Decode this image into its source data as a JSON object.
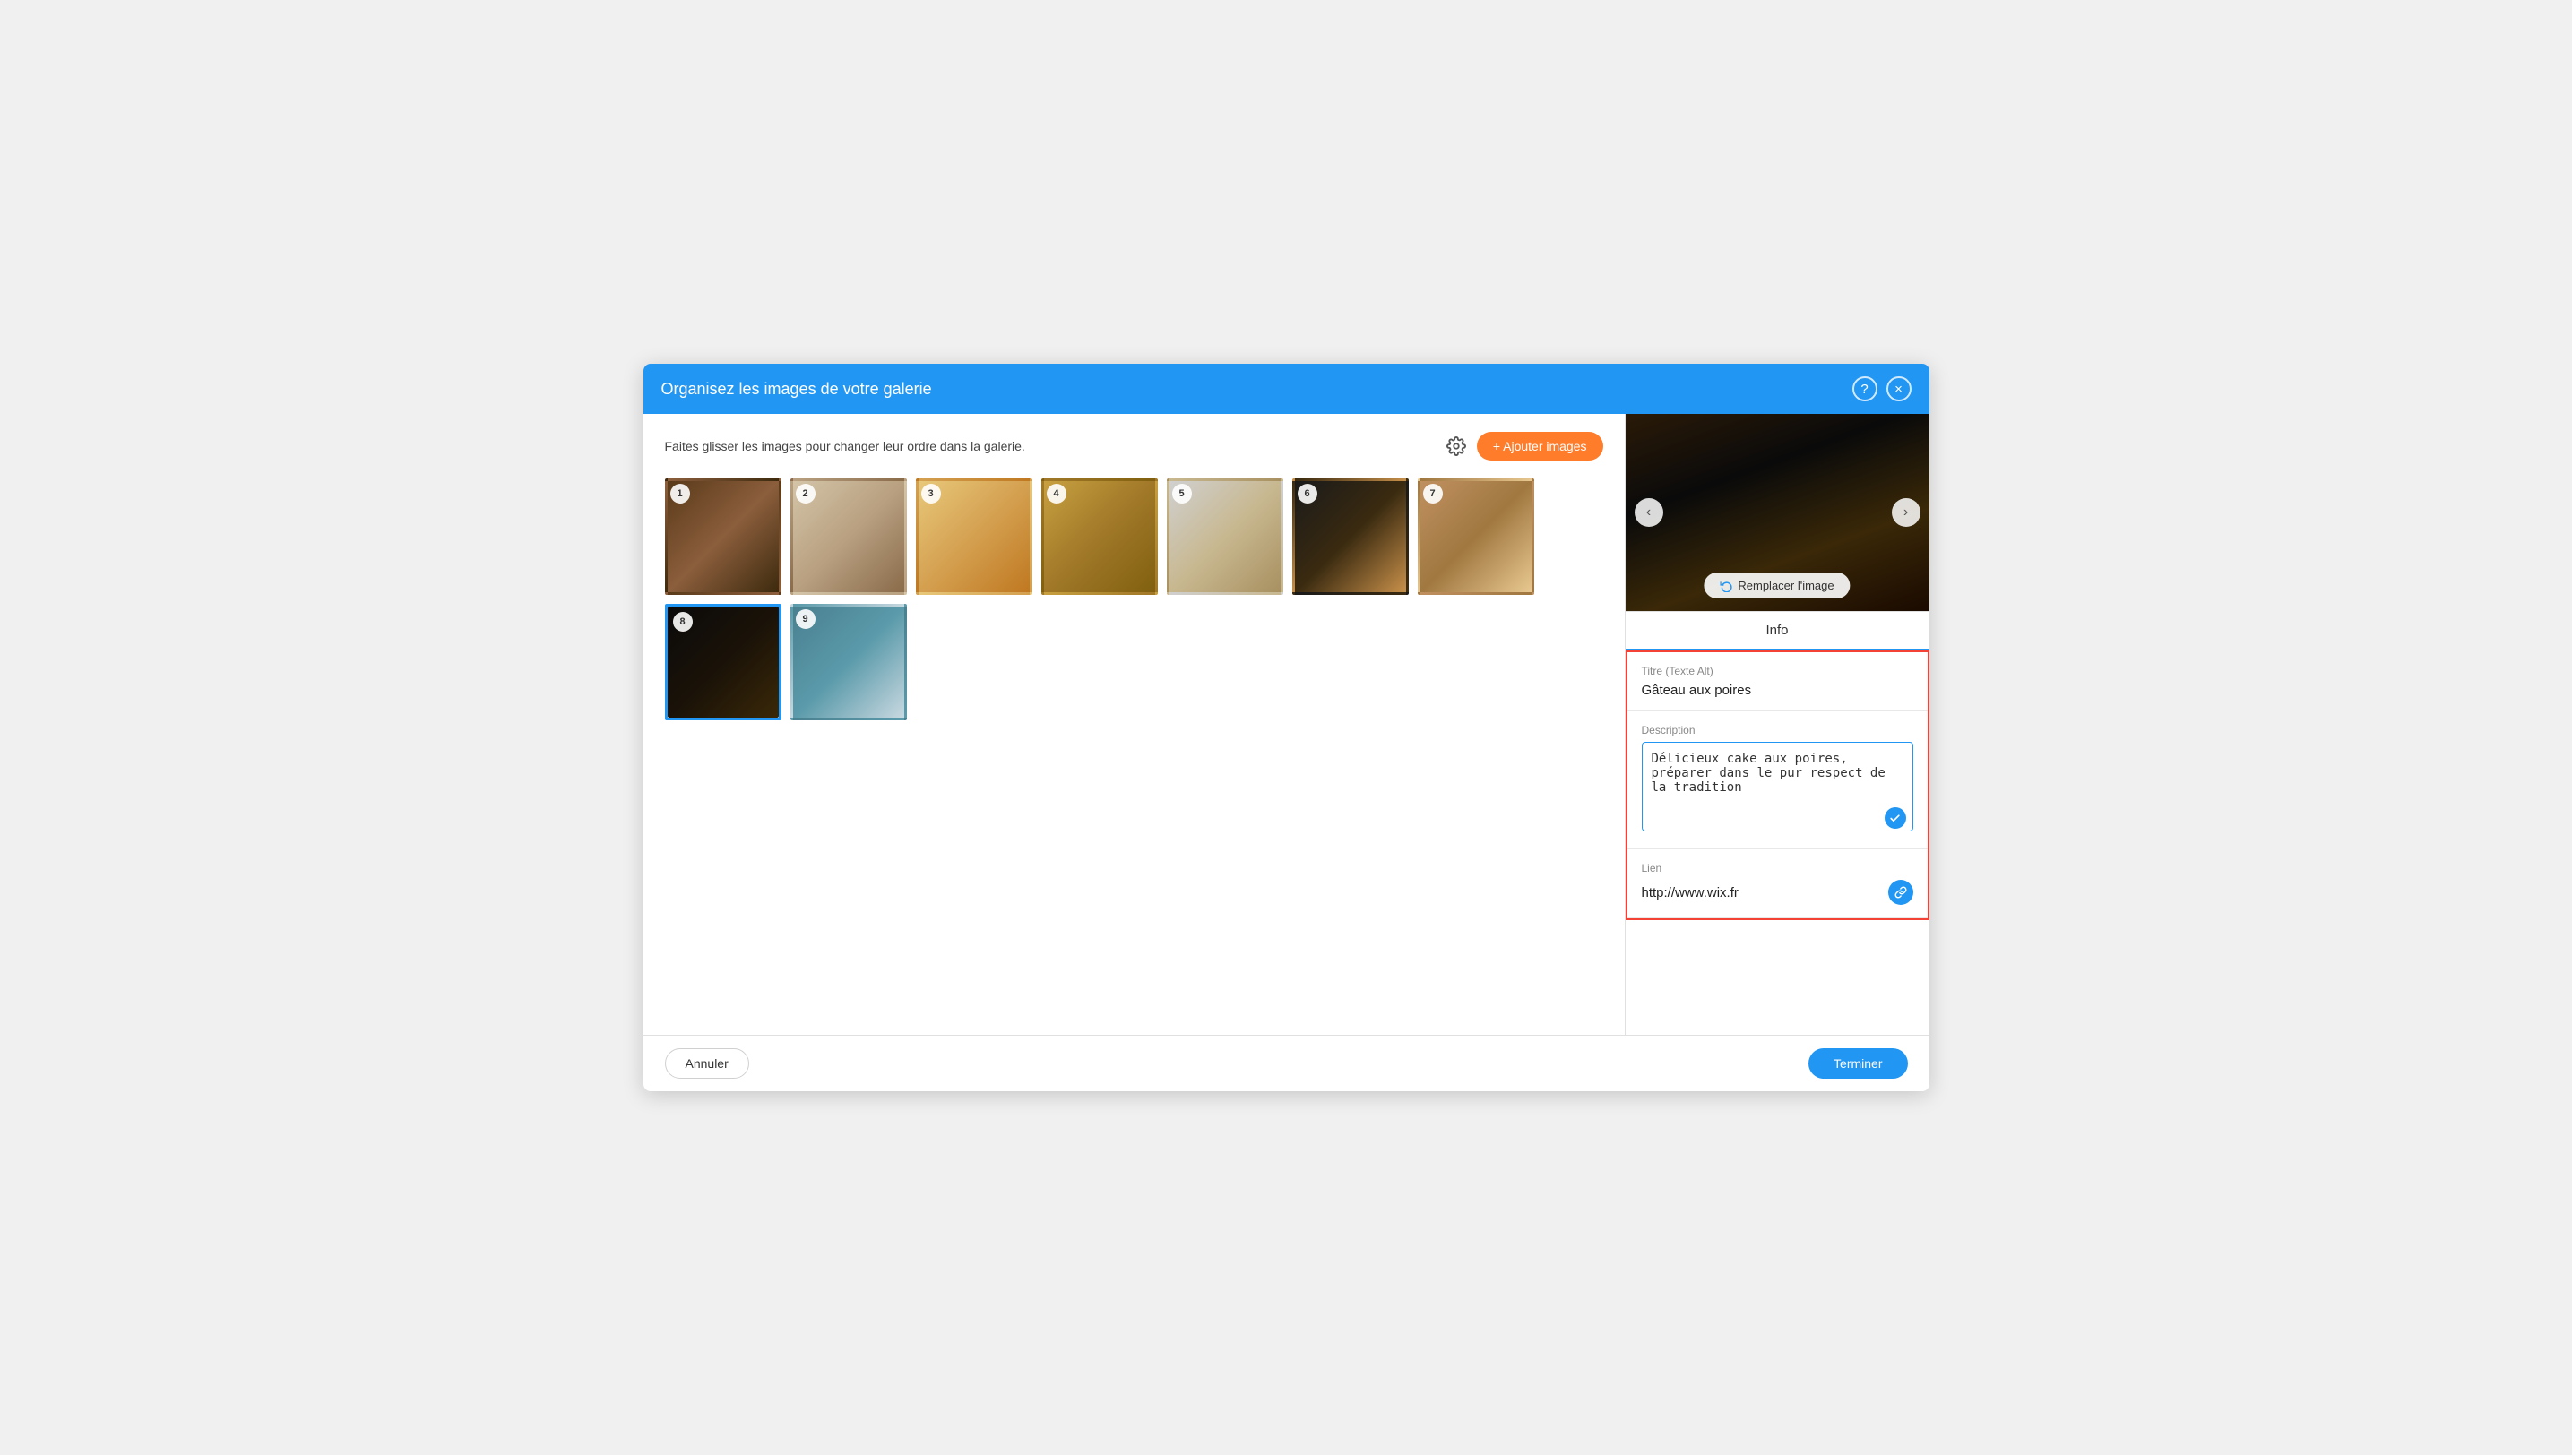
{
  "header": {
    "title": "Organisez les images de votre galerie",
    "help_label": "?",
    "close_label": "×"
  },
  "toolbar": {
    "instruction": "Faites glisser les images pour changer leur ordre dans la galerie.",
    "add_button_label": "+ Ajouter images"
  },
  "gallery": {
    "images": [
      {
        "number": 1,
        "class": "img-1",
        "selected": false
      },
      {
        "number": 2,
        "class": "img-2",
        "selected": false
      },
      {
        "number": 3,
        "class": "img-3",
        "selected": false
      },
      {
        "number": 4,
        "class": "img-4",
        "selected": false
      },
      {
        "number": 5,
        "class": "img-5",
        "selected": false
      },
      {
        "number": 6,
        "class": "img-6",
        "selected": false
      },
      {
        "number": 7,
        "class": "img-7",
        "selected": false
      },
      {
        "number": 8,
        "class": "img-8",
        "selected": true
      },
      {
        "number": 9,
        "class": "img-9",
        "selected": false
      }
    ]
  },
  "preview": {
    "replace_label": "Remplacer l'image",
    "prev_label": "‹",
    "next_label": "›"
  },
  "info": {
    "tab_label": "Info",
    "title_label": "Titre (Texte Alt)",
    "title_value": "Gâteau aux poires",
    "description_label": "Description",
    "description_value": "Délicieux cake aux poires, préparer dans le pur respect de la tradition",
    "link_label": "Lien",
    "link_value": "http://www.wix.fr"
  },
  "footer": {
    "cancel_label": "Annuler",
    "finish_label": "Terminer"
  }
}
